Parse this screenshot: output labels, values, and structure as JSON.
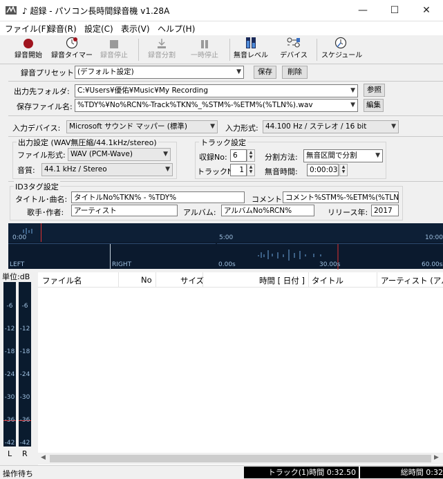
{
  "window": {
    "title": "♪ 超録 - パソコン長時間録音機 v1.28A",
    "minimize": "—",
    "maximize": "☐",
    "close": "✕"
  },
  "menu": [
    "ファイル(F)",
    "録音(R)",
    "設定(C)",
    "表示(V)",
    "ヘルプ(H)"
  ],
  "toolbar": {
    "record": "録音開始",
    "timer": "録音タイマー",
    "stop": "録音停止",
    "split": "録音分割",
    "pause": "一時停止",
    "silence_level": "無音レベル",
    "device": "デバイス",
    "schedule": "スケジュール"
  },
  "preset": {
    "label": "録音プリセット:",
    "value": "(デフォルト設定)",
    "save": "保存",
    "delete": "削除"
  },
  "output": {
    "folder_label": "出力先フォルダ:",
    "folder": "C:¥Users¥優佑¥Music¥My Recording",
    "browse": "参照",
    "filename_label": "保存ファイル名:",
    "filename": "%TDY%¥No%RCN%-Track%TKN%_%STM%-%ETM%(%TLN%).wav",
    "edit": "編集"
  },
  "input": {
    "device_label": "入力デバイス:",
    "device": "Microsoft サウンド マッパー (標準)",
    "format_label": "入力形式:",
    "format": "44.100 Hz / ステレオ / 16 bit"
  },
  "output_settings": {
    "title": "出力設定 (WAV無圧縮/44.1kHz/stereo)",
    "format_label": "ファイル形式:",
    "format": "WAV (PCM-Wave)",
    "quality_label": "音質:",
    "quality": "44.1 kHz / Stereo"
  },
  "track": {
    "title": "トラック設定",
    "rec_no_label": "収録No:",
    "rec_no": "6",
    "track_no_label": "トラックNo:",
    "track_no": "1",
    "split_label": "分割方法:",
    "split": "無音区間で分割",
    "silence_label": "無音時間:",
    "silence": "0:00:03"
  },
  "id3": {
    "title": "ID3タグ設定",
    "title_label": "タイトル･曲名:",
    "title_value": "タイトルNo%TKN% - %TDY%",
    "comment_label": "コメント:",
    "comment": "コメント%STM%-%ETM%(%TLN%)",
    "artist_label": "歌手･作者:",
    "artist": "アーティスト",
    "album_label": "アルバム:",
    "album": "アルバムNo%RCN%",
    "year_label": "リリース年:",
    "year": "2017"
  },
  "timeline": {
    "start": "0:00",
    "mid": "5:00",
    "end": "10:00",
    "left": "LEFT",
    "right": "RIGHT",
    "t0": "0.00s",
    "t30": "30.00s",
    "t60": "60.00s"
  },
  "meter": {
    "unit": "単位:dB",
    "ticks": [
      "-6",
      "-12",
      "-18",
      "-24",
      "-30",
      "-36",
      "-42"
    ],
    "l": "L",
    "r": "R"
  },
  "list": {
    "columns": [
      "ファイル名",
      "No",
      "サイズ",
      "時間 [ 日付 ]",
      "タイトル",
      "アーティスト (アルバ"
    ]
  },
  "status": {
    "text": "操作待ち",
    "track_time": "トラック(1)時間 0:32.50",
    "total_time": "総時間 0:32"
  },
  "colors": {
    "record": "#a0141e",
    "wave_bg": "#0b1a2e",
    "wave_line": "#6fa8e0",
    "marker": "#e03030"
  }
}
